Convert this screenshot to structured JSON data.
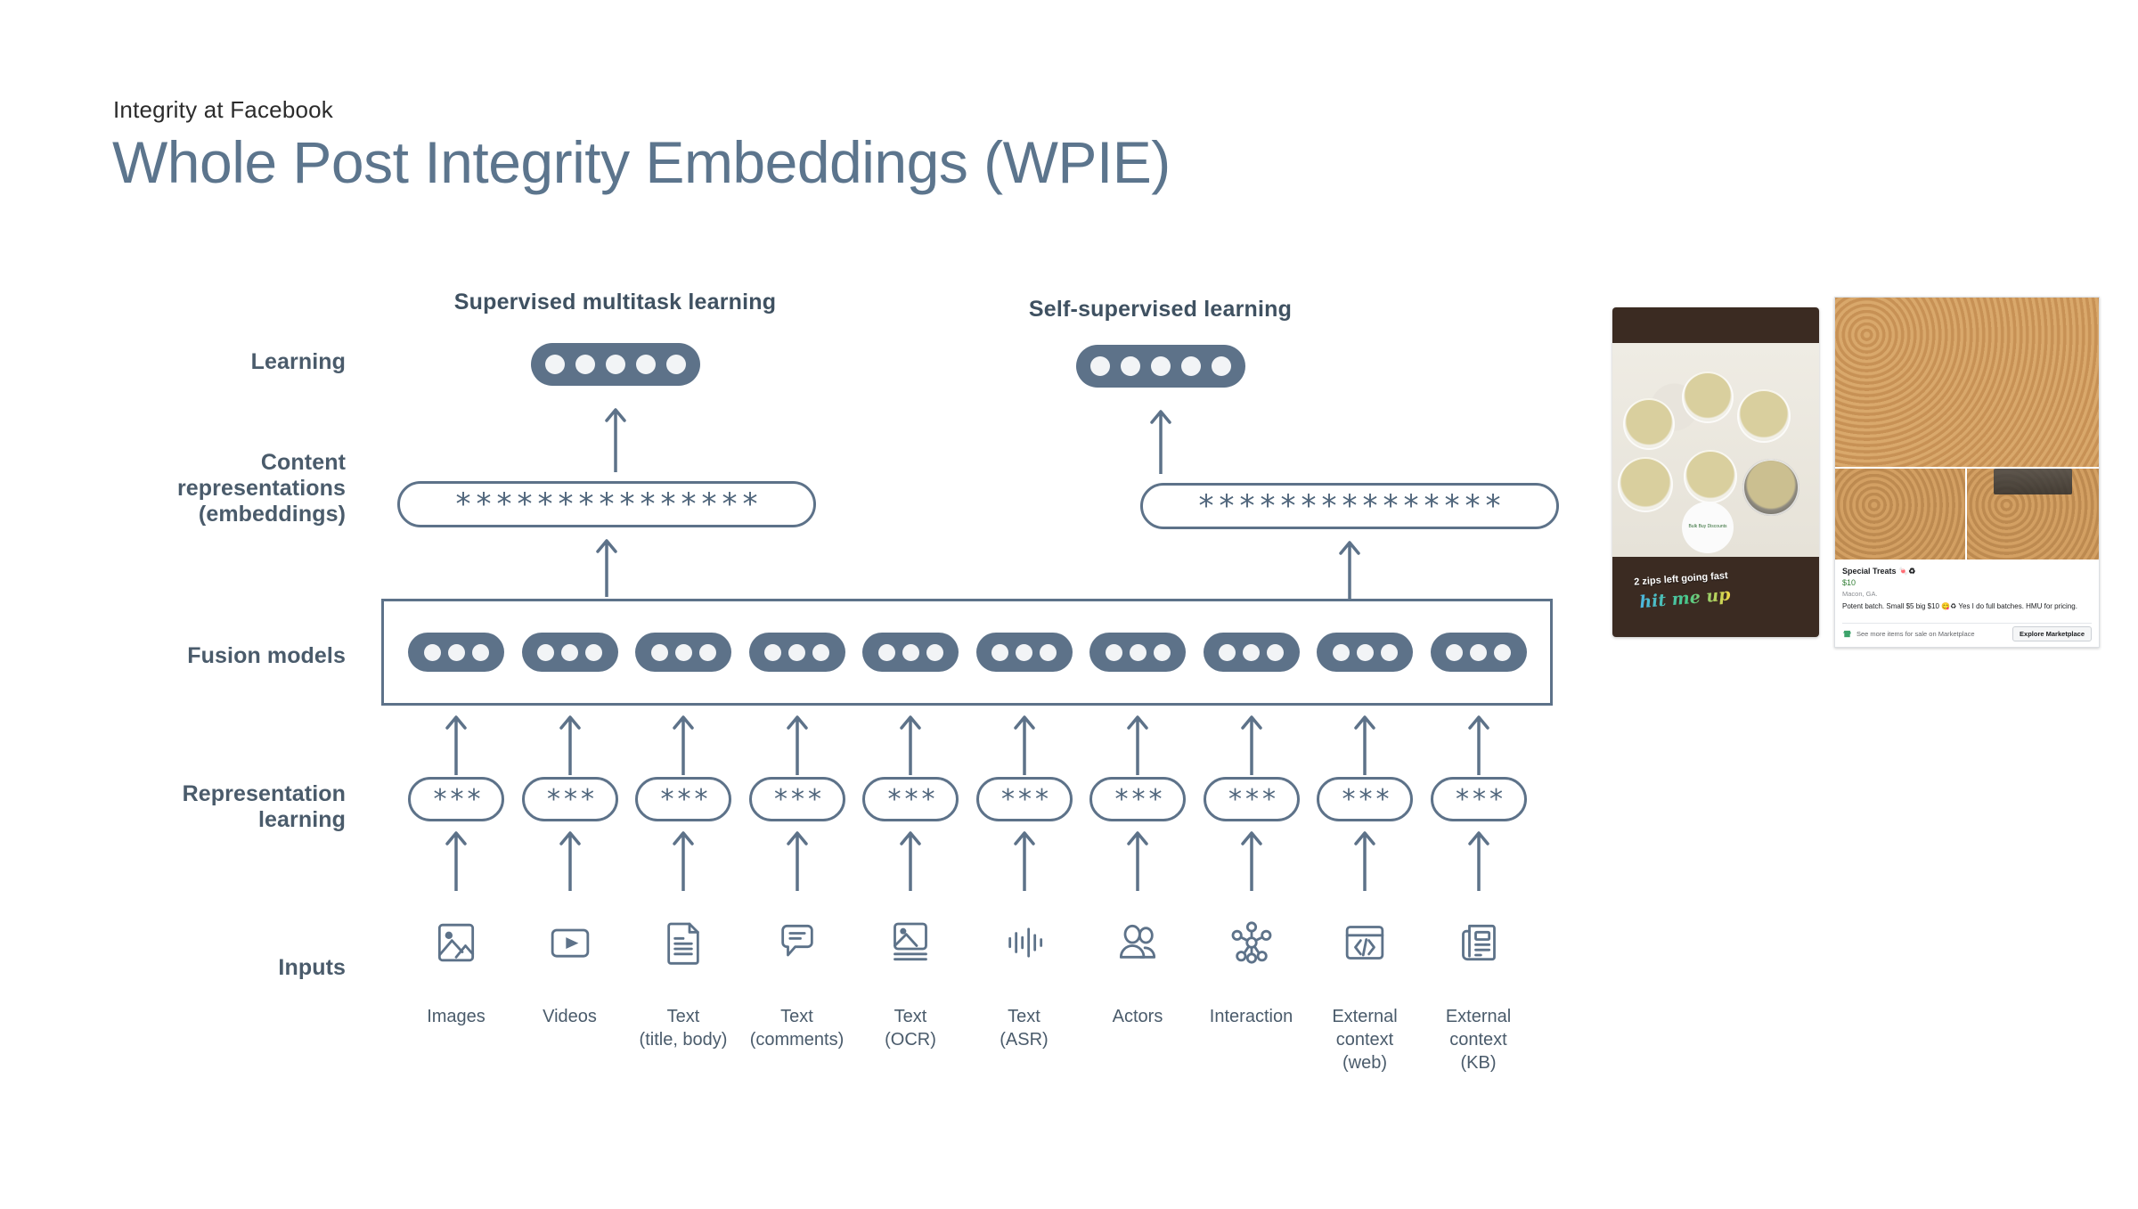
{
  "header": {
    "eyebrow": "Integrity at Facebook",
    "title": "Whole Post Integrity Embeddings (WPIE)",
    "title_color": "#5c758d"
  },
  "diagram": {
    "accent_color": "#5d7289",
    "row_labels": [
      {
        "id": "learning",
        "label": "Learning"
      },
      {
        "id": "content-representations",
        "label": "Content\nrepresentations\n(embeddings)"
      },
      {
        "id": "fusion-models",
        "label": "Fusion models"
      },
      {
        "id": "representation-learning",
        "label": "Representation\nlearning"
      },
      {
        "id": "inputs",
        "label": "Inputs"
      }
    ],
    "group_headings": [
      {
        "id": "supervised",
        "label": "Supervised multitask learning"
      },
      {
        "id": "self-supervised",
        "label": "Self-supervised learning"
      }
    ],
    "learning_nodes": [
      {
        "id": "supervised-learning-node",
        "dots": 5
      },
      {
        "id": "self-supervised-learning-node",
        "dots": 5
      }
    ],
    "embedding_pills": [
      {
        "id": "supervised-embedding",
        "symbol": "*",
        "count": 15
      },
      {
        "id": "self-supervised-embedding",
        "symbol": "*",
        "count": 15
      }
    ],
    "fusion_nodes_count": 10,
    "fusion_node_dots": 3,
    "representation_pills_count": 10,
    "representation_pill_symbol": "*",
    "representation_pill_count": 3,
    "inputs": [
      {
        "id": "images",
        "icon": "image-icon",
        "label": "Images"
      },
      {
        "id": "videos",
        "icon": "video-play-icon",
        "label": "Videos"
      },
      {
        "id": "text-title-body",
        "icon": "document-icon",
        "label": "Text\n(title, body)"
      },
      {
        "id": "text-comments",
        "icon": "comment-icon",
        "label": "Text\n(comments)"
      },
      {
        "id": "text-ocr",
        "icon": "image-text-icon",
        "label": "Text\n(OCR)"
      },
      {
        "id": "text-asr",
        "icon": "audio-wave-icon",
        "label": "Text\n(ASR)"
      },
      {
        "id": "actors",
        "icon": "people-icon",
        "label": "Actors"
      },
      {
        "id": "interaction",
        "icon": "network-icon",
        "label": "Interaction"
      },
      {
        "id": "external-web",
        "icon": "code-browser-icon",
        "label": "External\ncontext\n(web)"
      },
      {
        "id": "external-kb",
        "icon": "newspaper-icon",
        "label": "External\ncontext\n(KB)"
      }
    ]
  },
  "examples": {
    "story": {
      "caption_top": "2 zips left going fast",
      "caption_bottom": "hit me up",
      "sticker_text": "Bulk Buy\nDiscounts"
    },
    "marketplace": {
      "title": "Special Treats 🍬♻",
      "price": "$10",
      "location": "Macon, GA.",
      "description": "Potent batch. Small $5 big $10 😋♻ Yes I do full batches. HMU for pricing.",
      "footer_text": "See more items for sale on Marketplace",
      "button_label": "Explore Marketplace"
    }
  }
}
